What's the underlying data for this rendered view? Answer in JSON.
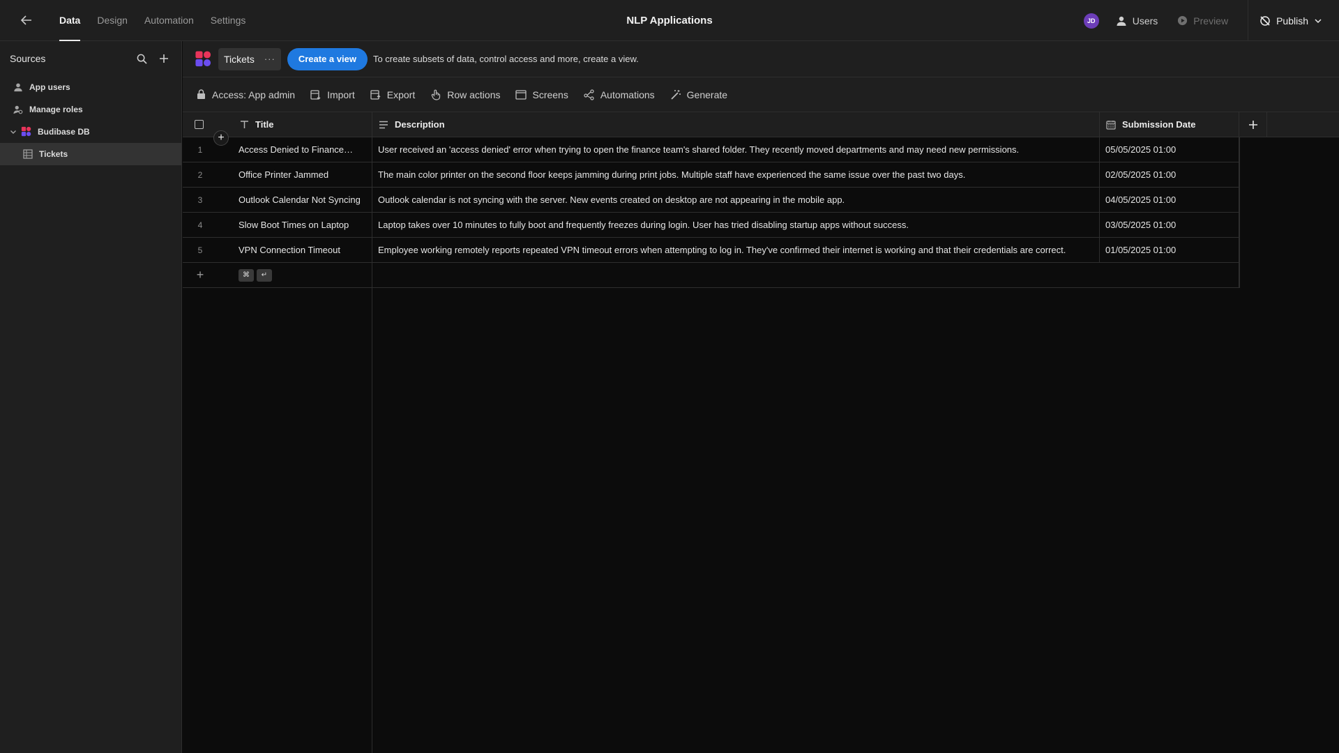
{
  "topbar": {
    "tabs": [
      {
        "label": "Data",
        "active": true
      },
      {
        "label": "Design",
        "active": false
      },
      {
        "label": "Automation",
        "active": false
      },
      {
        "label": "Settings",
        "active": false
      }
    ],
    "app_title": "NLP Applications",
    "avatar_initials": "JD",
    "users_label": "Users",
    "preview_label": "Preview",
    "publish_label": "Publish"
  },
  "sidebar": {
    "title": "Sources",
    "items": [
      {
        "label": "App users",
        "icon": "user-icon"
      },
      {
        "label": "Manage roles",
        "icon": "roles-icon"
      },
      {
        "label": "Budibase DB",
        "icon": "budibase-logo-icon"
      },
      {
        "label": "Tickets",
        "icon": "table-icon",
        "selected": true
      }
    ]
  },
  "toolbar": {
    "table_tab": "Tickets",
    "create_view_label": "Create a view",
    "hint": "To create subsets of data, control access and more, create a view.",
    "actions": [
      {
        "label": "Access: App admin",
        "icon": "lock-icon"
      },
      {
        "label": "Import",
        "icon": "import-icon"
      },
      {
        "label": "Export",
        "icon": "export-icon"
      },
      {
        "label": "Row actions",
        "icon": "row-actions-icon"
      },
      {
        "label": "Screens",
        "icon": "screens-icon"
      },
      {
        "label": "Automations",
        "icon": "automations-icon"
      },
      {
        "label": "Generate",
        "icon": "magic-wand-icon"
      }
    ]
  },
  "grid": {
    "columns": {
      "title": "Title",
      "description": "Description",
      "date": "Submission Date"
    },
    "rows": [
      {
        "num": "1",
        "title": "Access Denied to Finance…",
        "description": "User received an 'access denied' error when trying to open the finance team's shared folder. They recently moved departments and may need new permissions.",
        "date": "05/05/2025 01:00"
      },
      {
        "num": "2",
        "title": "Office Printer Jammed",
        "description": "The main color printer on the second floor keeps jamming during print jobs. Multiple staff have experienced the same issue over the past two days.",
        "date": "02/05/2025 01:00"
      },
      {
        "num": "3",
        "title": "Outlook Calendar Not Syncing",
        "description": "Outlook calendar is not syncing with the server. New events created on desktop are not appearing in the mobile app.",
        "date": "04/05/2025 01:00"
      },
      {
        "num": "4",
        "title": "Slow Boot Times on Laptop",
        "description": "Laptop takes over 10 minutes to fully boot and frequently freezes during login. User has tried disabling startup apps without success.",
        "date": "03/05/2025 01:00"
      },
      {
        "num": "5",
        "title": "VPN Connection Timeout",
        "description": "Employee working remotely reports repeated VPN timeout errors when attempting to log in. They've confirmed their internet is working and that their credentials are correct.",
        "date": "01/05/2025 01:00"
      }
    ],
    "kbd_keys": [
      "⌘",
      "↵"
    ]
  },
  "colors": {
    "accent": "#1f79e0",
    "avatar": "#6c3db8"
  }
}
